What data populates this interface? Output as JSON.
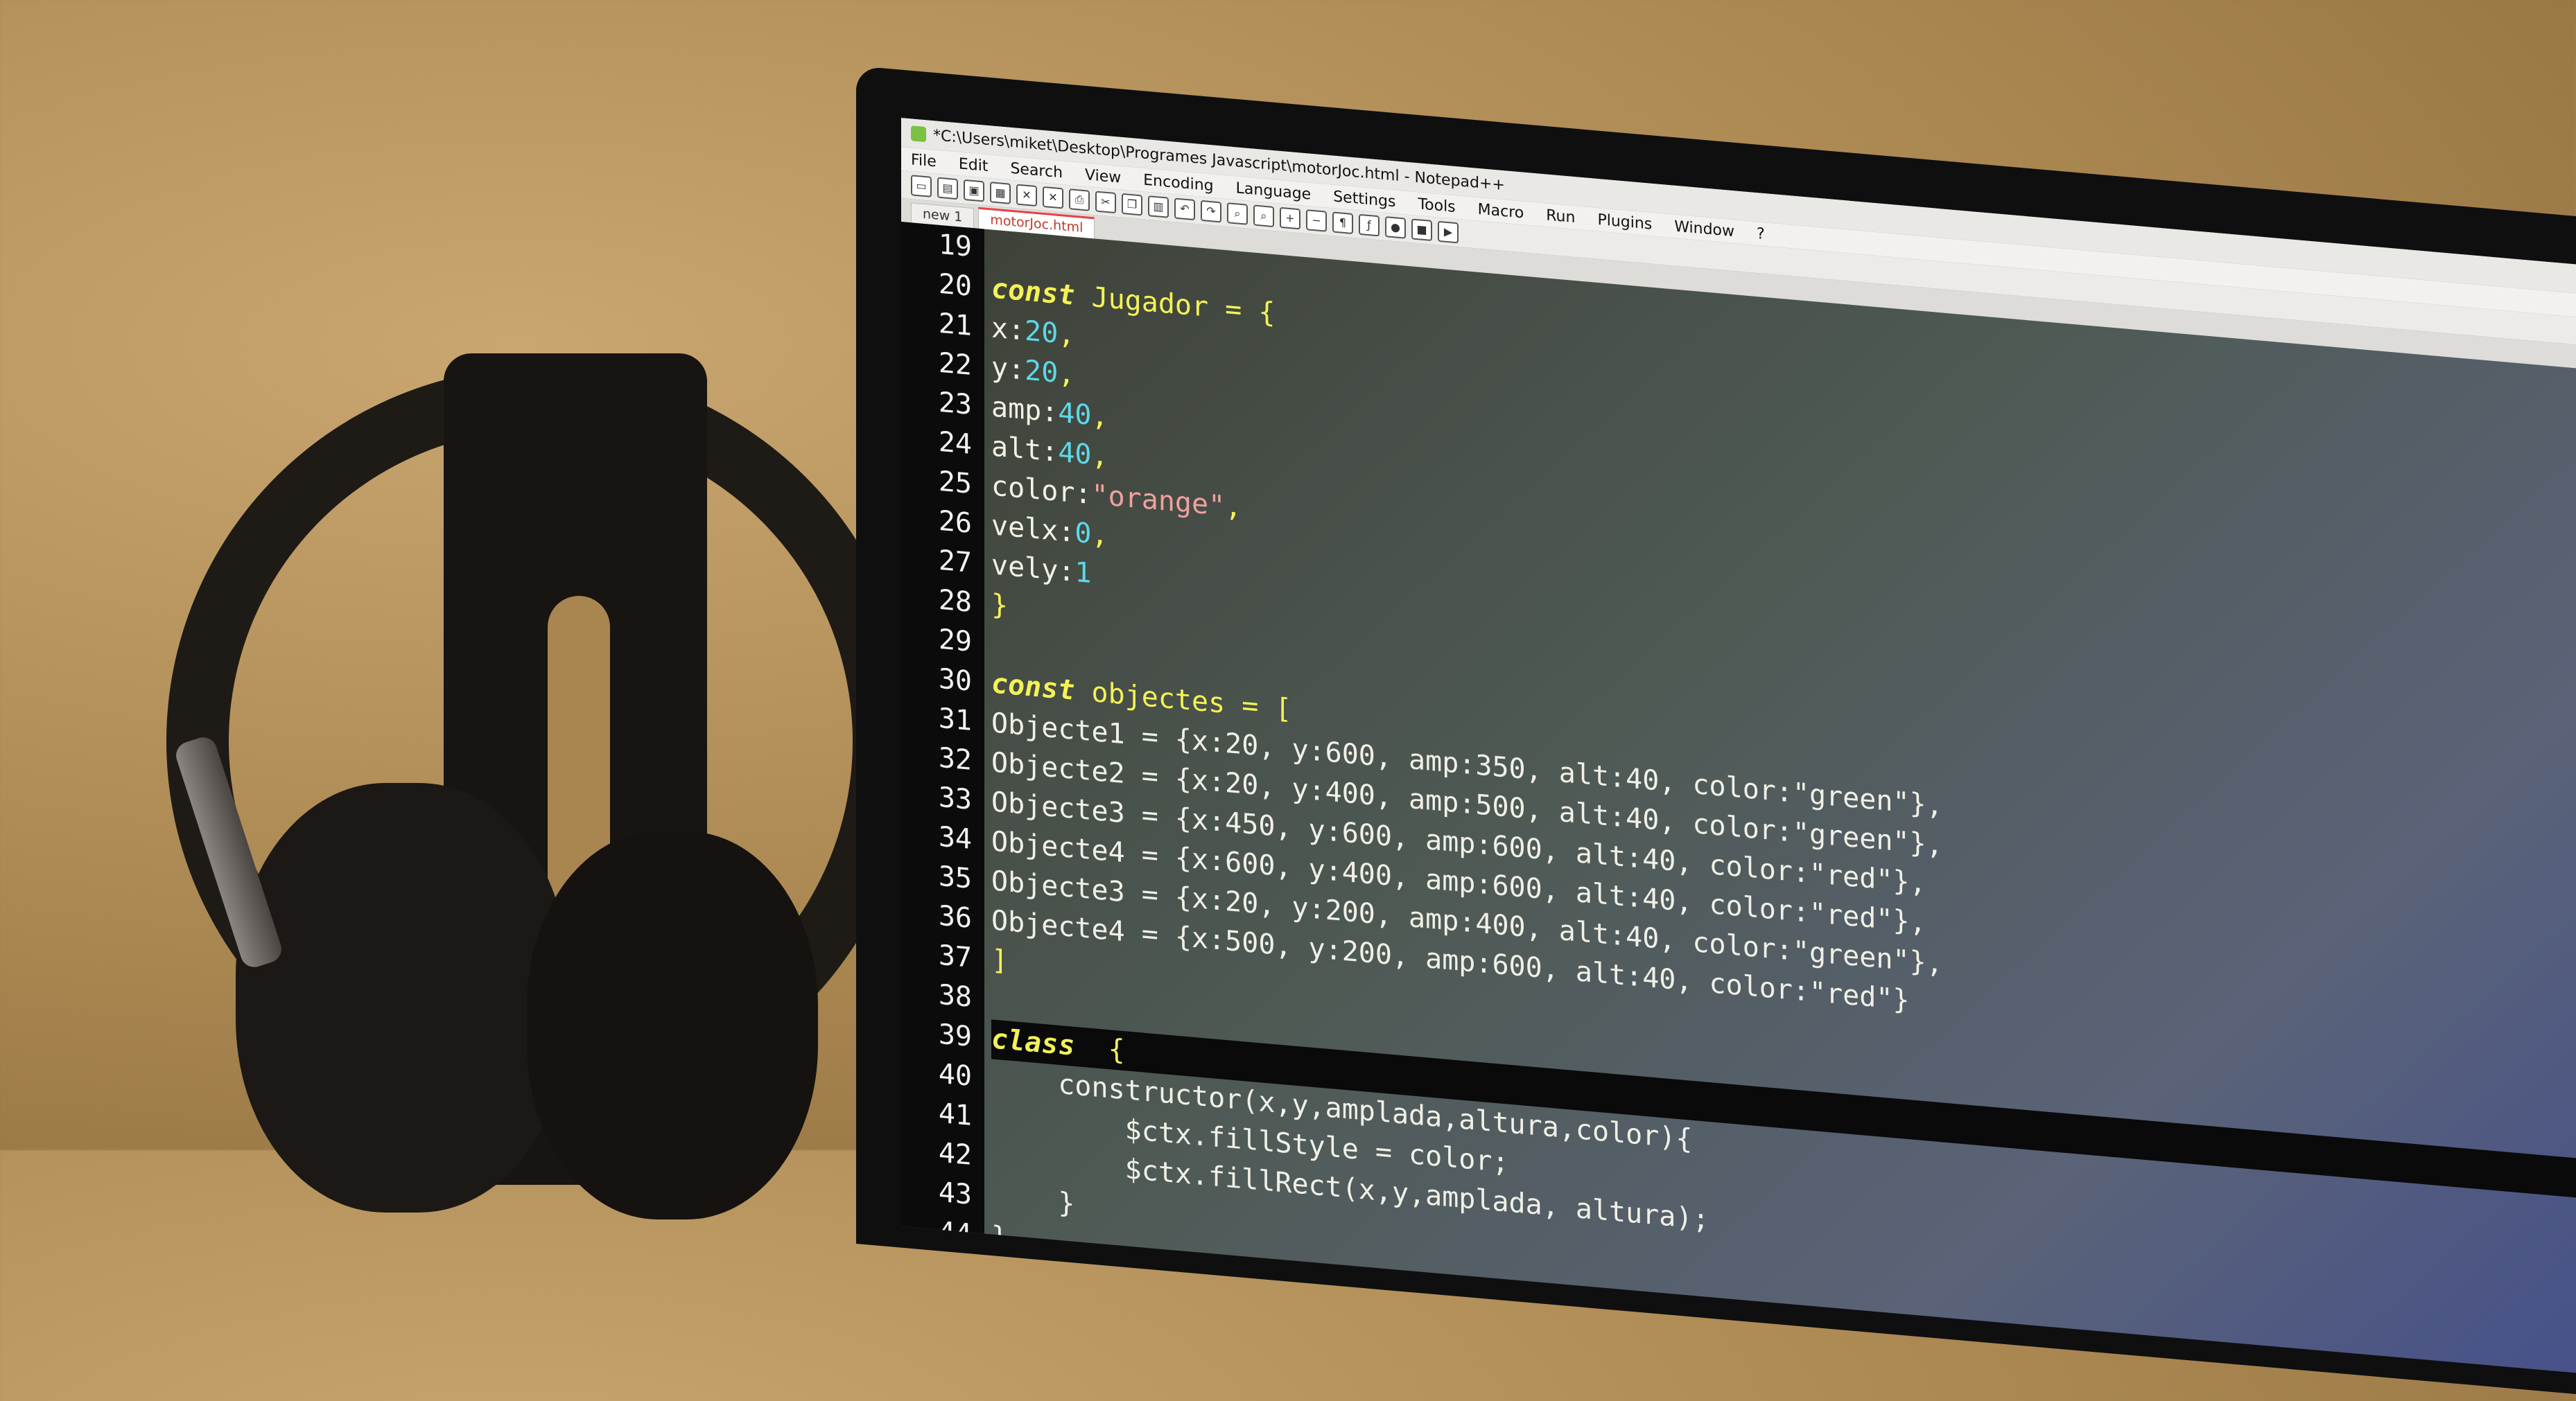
{
  "window": {
    "title": "*C:\\Users\\miket\\Desktop\\Programes Javascript\\motorJoc.html - Notepad++"
  },
  "menu": [
    "File",
    "Edit",
    "Search",
    "View",
    "Encoding",
    "Language",
    "Settings",
    "Tools",
    "Macro",
    "Run",
    "Plugins",
    "Window",
    "?"
  ],
  "tabs": [
    {
      "label": "new 1",
      "active": false
    },
    {
      "label": "motorJoc.html",
      "active": true
    }
  ],
  "toolbar_icons": [
    "new-file-icon",
    "open-file-icon",
    "save-icon",
    "save-all-icon",
    "close-icon",
    "close-all-icon",
    "print-icon",
    "cut-icon",
    "copy-icon",
    "paste-icon",
    "undo-icon",
    "redo-icon",
    "find-icon",
    "replace-icon",
    "zoom-in-icon",
    "zoom-out-icon",
    "sync-v-icon",
    "sync-h-icon",
    "word-wrap-icon",
    "all-chars-icon",
    "indent-guide-icon",
    "udl-icon",
    "doc-map-icon",
    "function-list-icon",
    "folder-workspace-icon",
    "monitor-icon",
    "record-macro-icon",
    "stop-macro-icon",
    "play-macro-icon",
    "run-macro-icon",
    "save-macro-icon"
  ],
  "line_numbers": [
    "19",
    "20",
    "21",
    "22",
    "23",
    "24",
    "25",
    "26",
    "27",
    "28",
    "29",
    "30",
    "31",
    "32",
    "33",
    "34",
    "35",
    "36",
    "37",
    "38",
    "39",
    "40",
    "41",
    "42",
    "43",
    "44"
  ],
  "code": {
    "l19": "",
    "l20_kw": "const",
    "l20_rest": " Jugador = {",
    "l21_key": "x:",
    "l21_val": "20",
    "l21_end": ",",
    "l22_key": "y:",
    "l22_val": "20",
    "l22_end": ",",
    "l23_key": "amp:",
    "l23_val": "40",
    "l23_end": ",",
    "l24_key": "alt:",
    "l24_val": "40",
    "l24_end": ",",
    "l25_key": "color:",
    "l25_val": "\"orange\"",
    "l25_end": ",",
    "l26_key": "velx:",
    "l26_val": "0",
    "l26_end": ",",
    "l27_key": "vely:",
    "l27_val": "1",
    "l28": "}",
    "l29": "",
    "l30_kw": "const",
    "l30_rest": " objectes = [",
    "objects": [
      {
        "name": "Objecte1",
        "x": "20",
        "y": "600",
        "amp": "350",
        "alt": "40",
        "color": null,
        "end": ""
      },
      {
        "name": "Objecte2",
        "x": "20",
        "y": "400",
        "amp": "500",
        "alt": "40",
        "color": "\"green\"",
        "end": "},"
      },
      {
        "name": "Objecte3",
        "x": "450",
        "y": "600",
        "amp": "600",
        "alt": "40",
        "color": "\"green\"",
        "end": "},"
      },
      {
        "name": "Objecte4",
        "x": "600",
        "y": "400",
        "amp": "600",
        "alt": "40",
        "color": "\"red\"",
        "end": "},"
      },
      {
        "name": "Objecte3",
        "x": "20",
        "y": "200",
        "amp": "400",
        "alt": "40",
        "color": "\"red\"",
        "end": "},"
      },
      {
        "name": "Objecte4",
        "x": "500",
        "y": "200",
        "amp": "600",
        "alt": "40",
        "color": "\"green\"",
        "end": "},"
      }
    ],
    "obj1_raw": "Objecte1 = {x:20, y:600, amp:350, alt:40, color:\"green\"},",
    "obj2_raw": "Objecte2 = {x:20, y:400, amp:500, alt:40, color:\"green\"},",
    "obj3_raw": "Objecte3 = {x:450, y:600, amp:600, alt:40, color:\"red\"},",
    "obj4_raw": "Objecte4 = {x:600, y:400, amp:600, alt:40, color:\"red\"},",
    "obj5_raw": "Objecte3 = {x:20, y:200, amp:400, alt:40, color:\"green\"},",
    "obj6_raw": "Objecte4 = {x:500, y:200, amp:600, alt:40, color:\"red\"}",
    "l37": "]",
    "l38": "",
    "l39_kw": "class",
    "l39_rest": "  {",
    "l40": "    constructor(x,y,amplada,altura,color){",
    "l41": "        $ctx.fillStyle = color;",
    "l42": "        $ctx.fillRect(x,y,amplada, altura);",
    "l43": "    }",
    "l44": "}"
  },
  "colors": {
    "keyword": "#f4f256",
    "number": "#5ed7e8",
    "string": "#f0a0a0",
    "gutter_bg": "#0b0b0b"
  }
}
